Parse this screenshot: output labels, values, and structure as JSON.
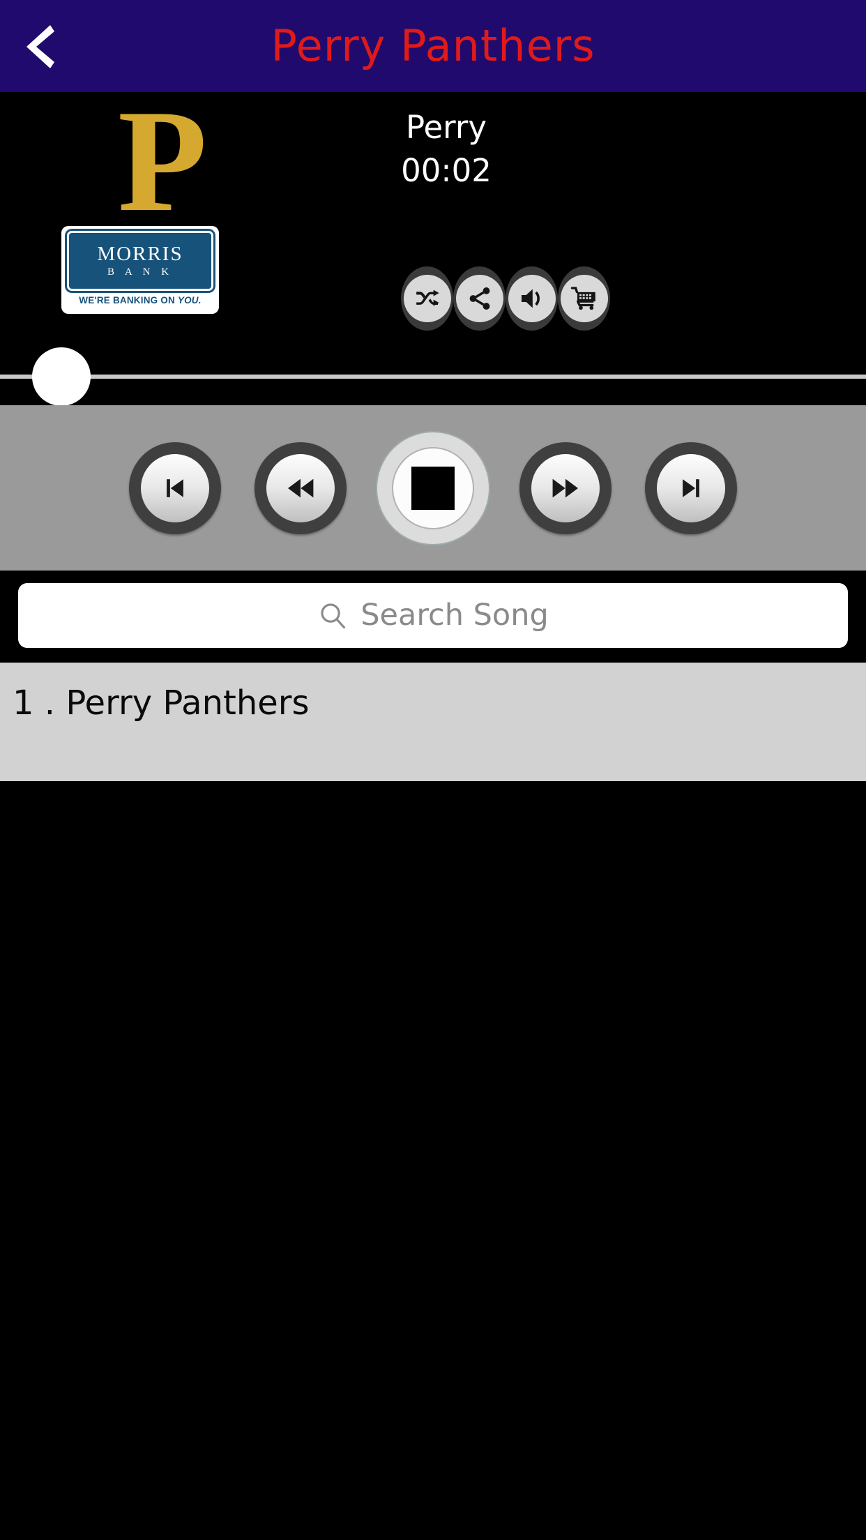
{
  "header": {
    "back_icon": "chevron-left-icon",
    "title": "Perry Panthers",
    "bg_color": "#200A6E",
    "title_color": "#E01A1A"
  },
  "artwork": {
    "monogram": "P",
    "monogram_color": "#D5A82F",
    "sponsor": {
      "name": "MORRIS",
      "subname": "B A N K",
      "tagline_prefix": "WE'RE BANKING ON ",
      "tagline_emphasis": "YOU.",
      "plate_color": "#17527A"
    }
  },
  "now_playing": {
    "track_title": "Perry",
    "elapsed_time": "00:02"
  },
  "actions": [
    {
      "name": "shuffle-button",
      "icon": "shuffle-icon",
      "label": "Shuffle"
    },
    {
      "name": "share-button",
      "icon": "share-icon",
      "label": "Share"
    },
    {
      "name": "volume-button",
      "icon": "volume-icon",
      "label": "Volume"
    },
    {
      "name": "cart-button",
      "icon": "shopping-cart-icon",
      "label": "Store"
    }
  ],
  "progress": {
    "value_percent": 7,
    "track_color": "#C9C9C9",
    "thumb_color": "#FFFFFF"
  },
  "transport": {
    "bg_color": "#9A9A9A",
    "buttons": [
      {
        "name": "previous-track-button",
        "icon": "skip-previous-icon",
        "label": "Previous"
      },
      {
        "name": "rewind-button",
        "icon": "rewind-icon",
        "label": "Rewind"
      },
      {
        "name": "stop-button",
        "icon": "stop-icon",
        "label": "Stop"
      },
      {
        "name": "fast-forward-button",
        "icon": "fast-forward-icon",
        "label": "Fast Forward"
      },
      {
        "name": "next-track-button",
        "icon": "skip-next-icon",
        "label": "Next"
      }
    ]
  },
  "search": {
    "placeholder": "Search Song",
    "value": "",
    "icon": "search-icon"
  },
  "song_list": {
    "rows": [
      {
        "index_label": "1 .",
        "title": "Perry Panthers",
        "display": "1 . Perry Panthers"
      }
    ]
  }
}
